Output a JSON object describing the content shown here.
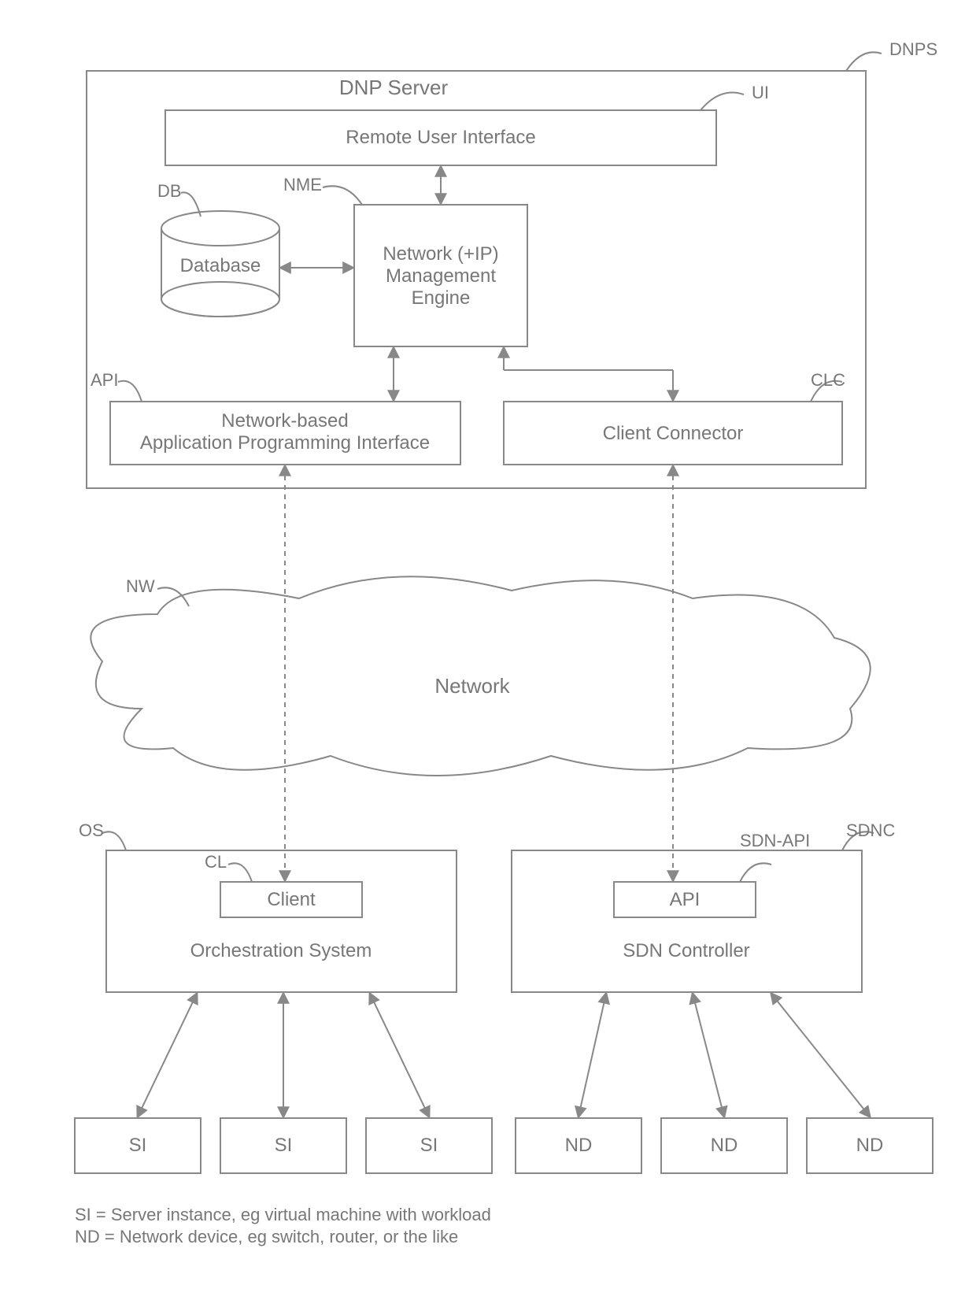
{
  "labels": {
    "dnps": "DNPS",
    "dnpserver": "DNP Server",
    "ui": "UI",
    "rui": "Remote User Interface",
    "db_tag": "DB",
    "db": "Database",
    "nme_tag": "NME",
    "nme1": "Network (+IP)",
    "nme2": "Management",
    "nme3": "Engine",
    "api_tag": "API",
    "api1": "Network-based",
    "api2": "Application Programming Interface",
    "clc_tag": "CLC",
    "clc": "Client Connector",
    "nw_tag": "NW",
    "nw": "Network",
    "os_tag": "OS",
    "cl_tag": "CL",
    "cl": "Client",
    "os": "Orchestration System",
    "sdnapi_tag": "SDN-API",
    "sdnc_tag": "SDNC",
    "sdnapi": "API",
    "sdnc": "SDN Controller",
    "si": "SI",
    "nd": "ND",
    "foot1": "SI = Server instance, eg virtual machine with workload",
    "foot2": "ND = Network device, eg switch, router, or the like"
  }
}
